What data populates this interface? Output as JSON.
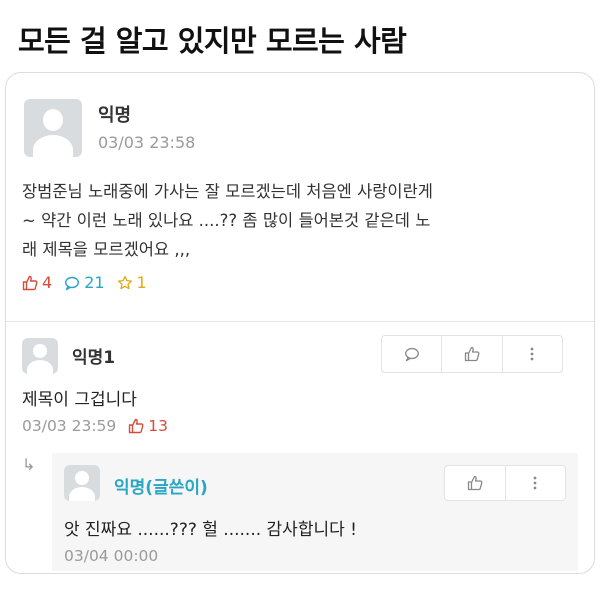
{
  "headline": "모든 걸 알고 있지만 모르는 사람",
  "post": {
    "author": "익명",
    "time": "03/03 23:58",
    "body": "장범준님 노래중에 가사는 잘 모르겠는데 처음엔 사랑이란게\n~ 약간 이런 노래 있나요 ....?? 좀 많이 들어본것 같은데 노\n래 제목을 모르겠어요 ,,,",
    "likes": "4",
    "comments": "21",
    "scraps": "1"
  },
  "comment": {
    "author": "익명1",
    "text": "제목이 그겁니다",
    "time": "03/03 23:59",
    "likes": "13"
  },
  "reply": {
    "arrow": "↳",
    "author": "익명(글쓴이)",
    "text": "앗 진짜요 ......??? 헐 ....... 감사합니다 !",
    "time": "03/04 00:00"
  },
  "colors": {
    "like": "#d64b3b",
    "comment": "#27a7c6",
    "scrap": "#e2a812",
    "writer": "#27a7c6"
  },
  "icons": [
    "thumbs-up-icon",
    "speech-bubble-icon",
    "star-icon",
    "more-vertical-icon",
    "reply-arrow-icon"
  ]
}
